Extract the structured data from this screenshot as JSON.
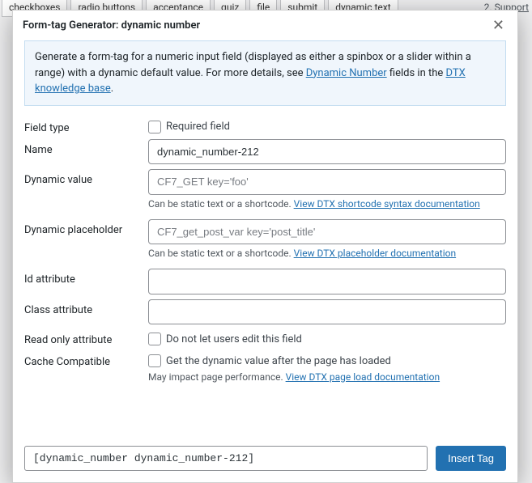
{
  "bg": {
    "tabs": [
      "checkboxes",
      "radio buttons",
      "acceptance",
      "quiz",
      "file",
      "submit",
      "dynamic text"
    ],
    "right": "2. Support"
  },
  "dialog": {
    "title": "Form-tag Generator: dynamic number",
    "close": "✕",
    "info_pre": "Generate a form-tag for a numeric input field (displayed as either a spinbox or a slider within a range) with a dynamic default value. For more details, see ",
    "info_link1": "Dynamic Number",
    "info_mid": " fields in the ",
    "info_link2": "DTX knowledge base",
    "info_post": "."
  },
  "rows": {
    "field_type_label": "Field type",
    "required_label": "Required field",
    "name_label": "Name",
    "name_value": "dynamic_number-212",
    "dyn_value_label": "Dynamic value",
    "dyn_value_placeholder": "CF7_GET key='foo'",
    "dyn_value_hint_pre": "Can be static text or a shortcode. ",
    "dyn_value_hint_link": "View DTX shortcode syntax documentation",
    "dyn_ph_label": "Dynamic placeholder",
    "dyn_ph_placeholder": "CF7_get_post_var key='post_title'",
    "dyn_ph_hint_pre": "Can be static text or a shortcode. ",
    "dyn_ph_hint_link": "View DTX placeholder documentation",
    "id_label": "Id attribute",
    "class_label": "Class attribute",
    "readonly_label": "Read only attribute",
    "readonly_chk": "Do not let users edit this field",
    "cache_label": "Cache Compatible",
    "cache_chk": "Get the dynamic value after the page has loaded",
    "cache_hint_pre": "May impact page performance. ",
    "cache_hint_link": "View DTX page load documentation"
  },
  "footer": {
    "generated": "[dynamic_number dynamic_number-212]",
    "insert": "Insert Tag"
  }
}
